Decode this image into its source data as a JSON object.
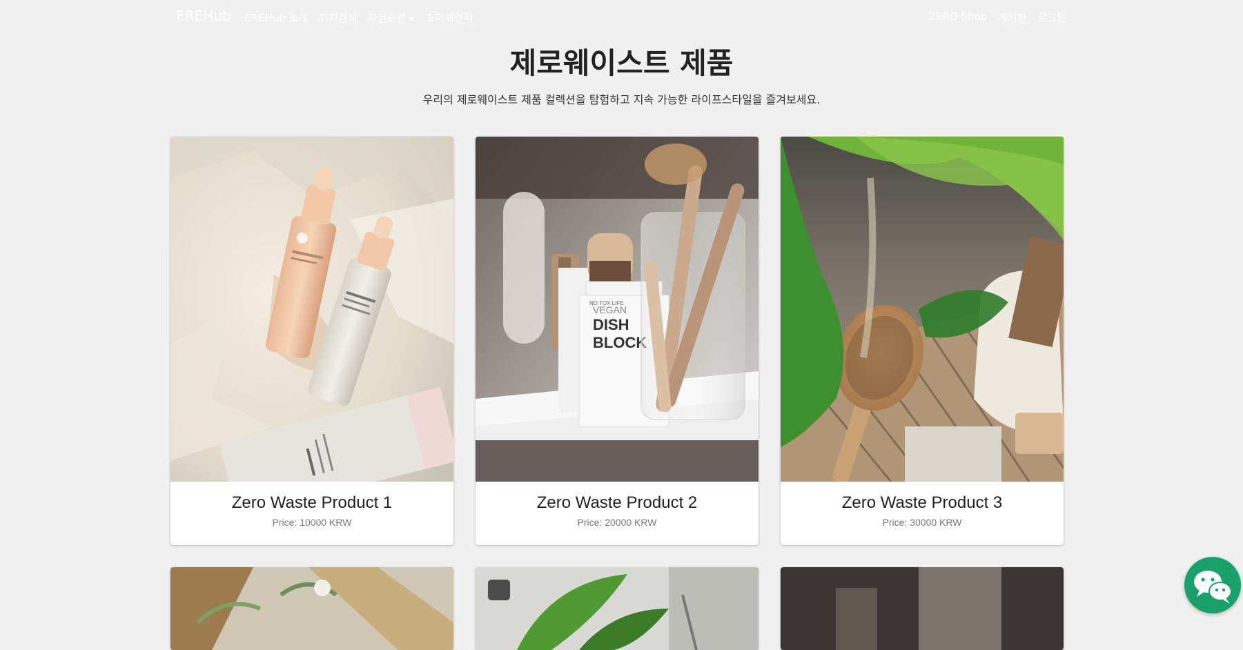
{
  "navbar": {
    "brand": "EREHub",
    "left_links": [
      "EREHub 소개",
      "위치검색",
      "자원순환",
      "초미세먼지"
    ],
    "right_links": [
      "ZERO Shop",
      "게시판",
      "로그인"
    ]
  },
  "main": {
    "title": "제로웨이스트 제품",
    "subtitle": "우리의 제로웨이스트 제품 컬렉션을 탐험하고 지속 가능한 라이프스타일을 즐겨보세요."
  },
  "products": [
    {
      "name": "Zero Waste Product 1",
      "price": "Price: 10000 KRW",
      "image": "skincare-serum-bottles-photo"
    },
    {
      "name": "Zero Waste Product 2",
      "price": "Price: 20000 KRW",
      "image": "vegan-dish-block-brushes-photo"
    },
    {
      "name": "Zero Waste Product 3",
      "price": "Price: 30000 KRW",
      "image": "bamboo-hairbrush-plant-photo"
    }
  ],
  "colors": {
    "page_bg": "#f0f0f0",
    "chat_button": "#1aa06b"
  },
  "icons": {
    "chat": "wechat-chat-icon"
  }
}
